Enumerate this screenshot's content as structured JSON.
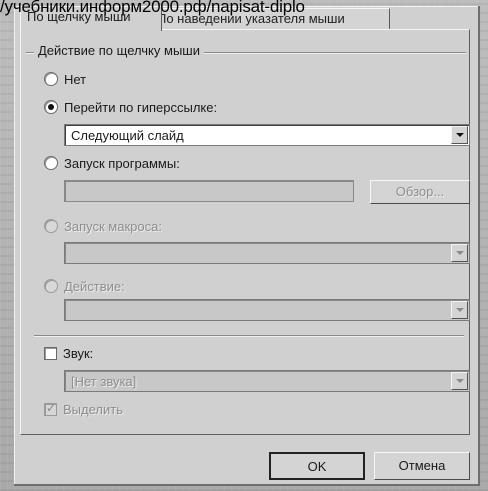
{
  "watermark": "/учебники.информ2000.рф/napisat-diplo",
  "tabs": [
    {
      "label": "По щелчку мыши",
      "active": true
    },
    {
      "label": "По наведении указателя мыши",
      "active": false
    }
  ],
  "group": {
    "title": "Действие по щелчку мыши"
  },
  "options": {
    "none": {
      "label": "Нет",
      "checked": false
    },
    "hyperlink": {
      "label": "Перейти по гиперссылке:",
      "checked": true,
      "value": "Следующий слайд"
    },
    "program": {
      "label": "Запуск программы:",
      "checked": false,
      "value": "",
      "browse_label": "Обзор..."
    },
    "macro": {
      "label": "Запуск макроса:",
      "checked": false,
      "disabled": true,
      "value": ""
    },
    "action": {
      "label": "Действие:",
      "checked": false,
      "disabled": true,
      "value": ""
    }
  },
  "sound": {
    "label": "Звук:",
    "checked": false,
    "value": "[Нет звука]"
  },
  "highlight": {
    "label": "Выделить",
    "checked": true,
    "disabled": true
  },
  "buttons": {
    "ok": "OK",
    "cancel": "Отмена"
  },
  "colors": {
    "dialog_bg": "#d0d0d0",
    "text": "#1a1a1a",
    "disabled_text": "#8e8e8e"
  }
}
